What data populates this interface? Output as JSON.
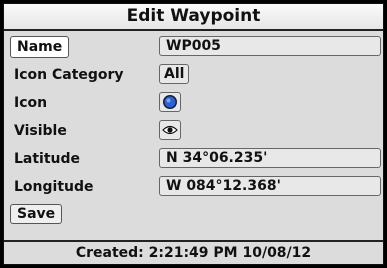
{
  "title": "Edit Waypoint",
  "fields": {
    "name_label": "Name",
    "name_value": "WP005",
    "icon_category_label": "Icon Category",
    "icon_category_value": "All",
    "icon_label": "Icon",
    "icon_name": "blue-circle-icon",
    "visible_label": "Visible",
    "visible_icon_name": "eye-icon",
    "latitude_label": "Latitude",
    "latitude_value": "N 34°06.235'",
    "longitude_label": "Longitude",
    "longitude_value": "W 084°12.368'"
  },
  "save_label": "Save",
  "status": "Created: 2:21:49 PM 10/08/12",
  "colors": {
    "waypoint_icon": "#2f5fd0",
    "title_bg": "#f2f2f2",
    "screen_bg": "#dcdcdc"
  }
}
